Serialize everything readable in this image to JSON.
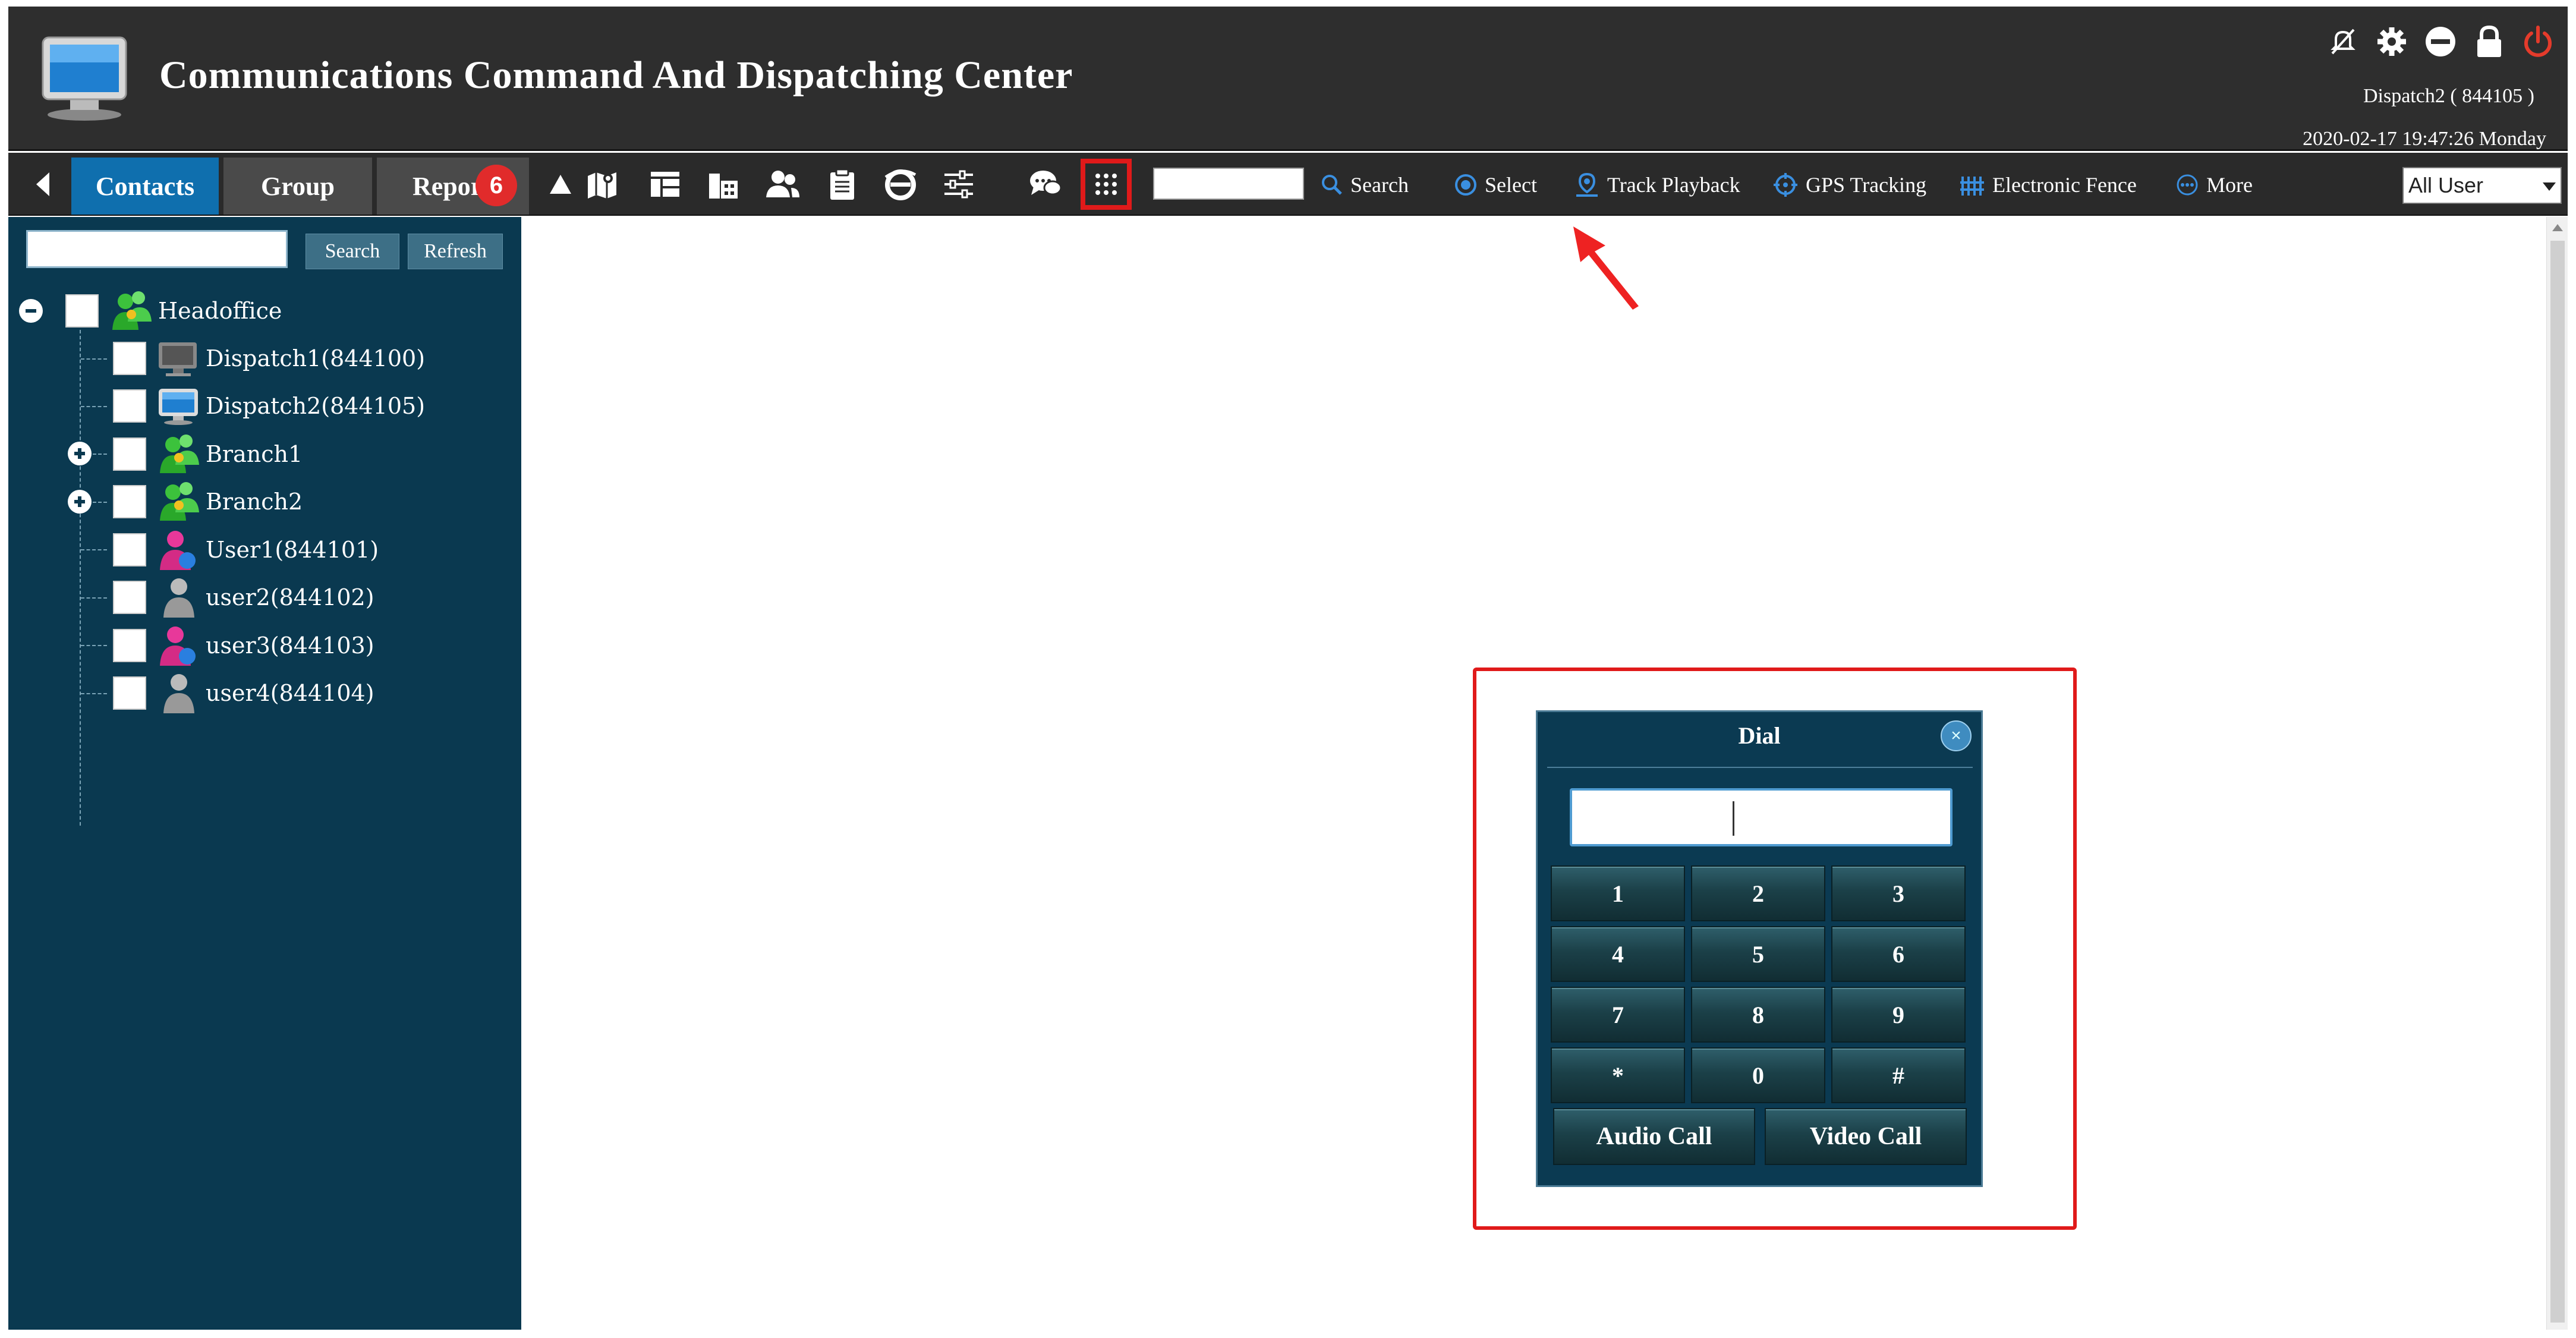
{
  "header": {
    "title": "Communications Command And Dispatching Center",
    "user": "Dispatch2 ( 844105 )",
    "datetime": "2020-02-17 19:47:26 Monday",
    "icons": [
      "mute-icon",
      "gear-icon",
      "minimize-icon",
      "lock-icon",
      "power-icon"
    ],
    "colors": {
      "power": "#e53b2b"
    }
  },
  "tabs": [
    {
      "label": "Contacts",
      "active": true
    },
    {
      "label": "Group",
      "active": false
    },
    {
      "label": "Repor",
      "active": false
    }
  ],
  "report_badge": "6",
  "nav_links": {
    "search": "Search",
    "select": "Select",
    "track_playback": "Track Playback",
    "gps_tracking": "GPS Tracking",
    "electronic_fence": "Electronic Fence",
    "more": "More"
  },
  "user_filter": "All User",
  "sidebar": {
    "search_label": "Search",
    "refresh_label": "Refresh",
    "tree": [
      {
        "label": "Headoffice",
        "type": "group"
      },
      {
        "label": "Dispatch1(844100)",
        "type": "dispatcher-offline"
      },
      {
        "label": "Dispatch2(844105)",
        "type": "dispatcher-online"
      },
      {
        "label": "Branch1",
        "type": "group"
      },
      {
        "label": "Branch2",
        "type": "group"
      },
      {
        "label": "User1(844101)",
        "type": "user-online"
      },
      {
        "label": "user2(844102)",
        "type": "user-offline"
      },
      {
        "label": "user3(844103)",
        "type": "user-online"
      },
      {
        "label": "user4(844104)",
        "type": "user-offline"
      }
    ]
  },
  "dial": {
    "title": "Dial",
    "keys": [
      "1",
      "2",
      "3",
      "4",
      "5",
      "6",
      "7",
      "8",
      "9",
      "*",
      "0",
      "#"
    ],
    "audio_call": "Audio Call",
    "video_call": "Video Call"
  },
  "colors": {
    "active_tab": "#0f6fae",
    "sidebar_bg": "#0a3950",
    "highlight": "#e01a1a"
  }
}
